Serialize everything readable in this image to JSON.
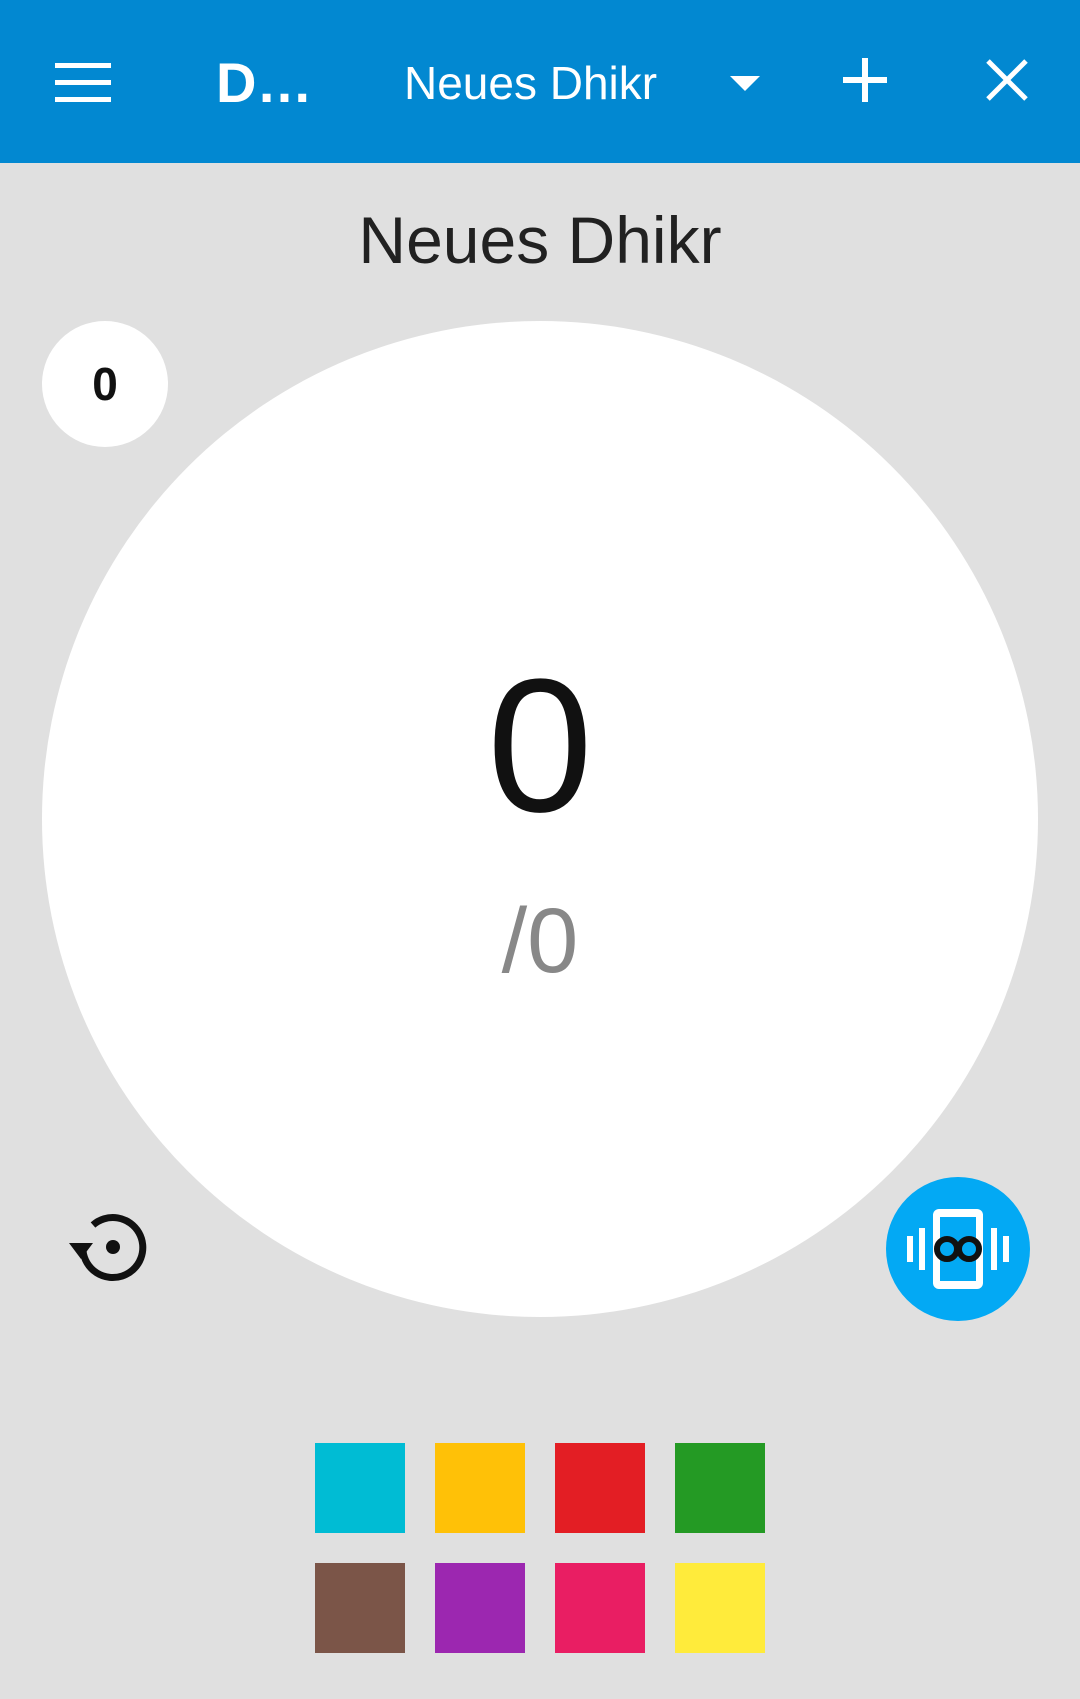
{
  "appbar": {
    "title": "Dhikr",
    "selected_dhikr": "Neues Dhikr",
    "icons": {
      "menu": "menu-icon",
      "dropdown": "caret-down-icon",
      "add": "plus-icon",
      "close": "close-icon"
    },
    "background_color": "#0288d1"
  },
  "counter": {
    "title": "Neues Dhikr",
    "count": "0",
    "target": "/0",
    "rounds": "0"
  },
  "actions": {
    "reset_icon": "reset-history-icon",
    "vibrate_icon": "vibrate-infinity-icon",
    "vibrate_color": "#03a9f4"
  },
  "colors": [
    {
      "name": "cyan",
      "hex": "#00bcd4"
    },
    {
      "name": "amber",
      "hex": "#ffc107"
    },
    {
      "name": "red",
      "hex": "#e31e24"
    },
    {
      "name": "green",
      "hex": "#249a24"
    },
    {
      "name": "brown",
      "hex": "#7b5548"
    },
    {
      "name": "purple",
      "hex": "#9c27b0"
    },
    {
      "name": "pink",
      "hex": "#e91e63"
    },
    {
      "name": "yellow",
      "hex": "#ffeb3b"
    }
  ]
}
